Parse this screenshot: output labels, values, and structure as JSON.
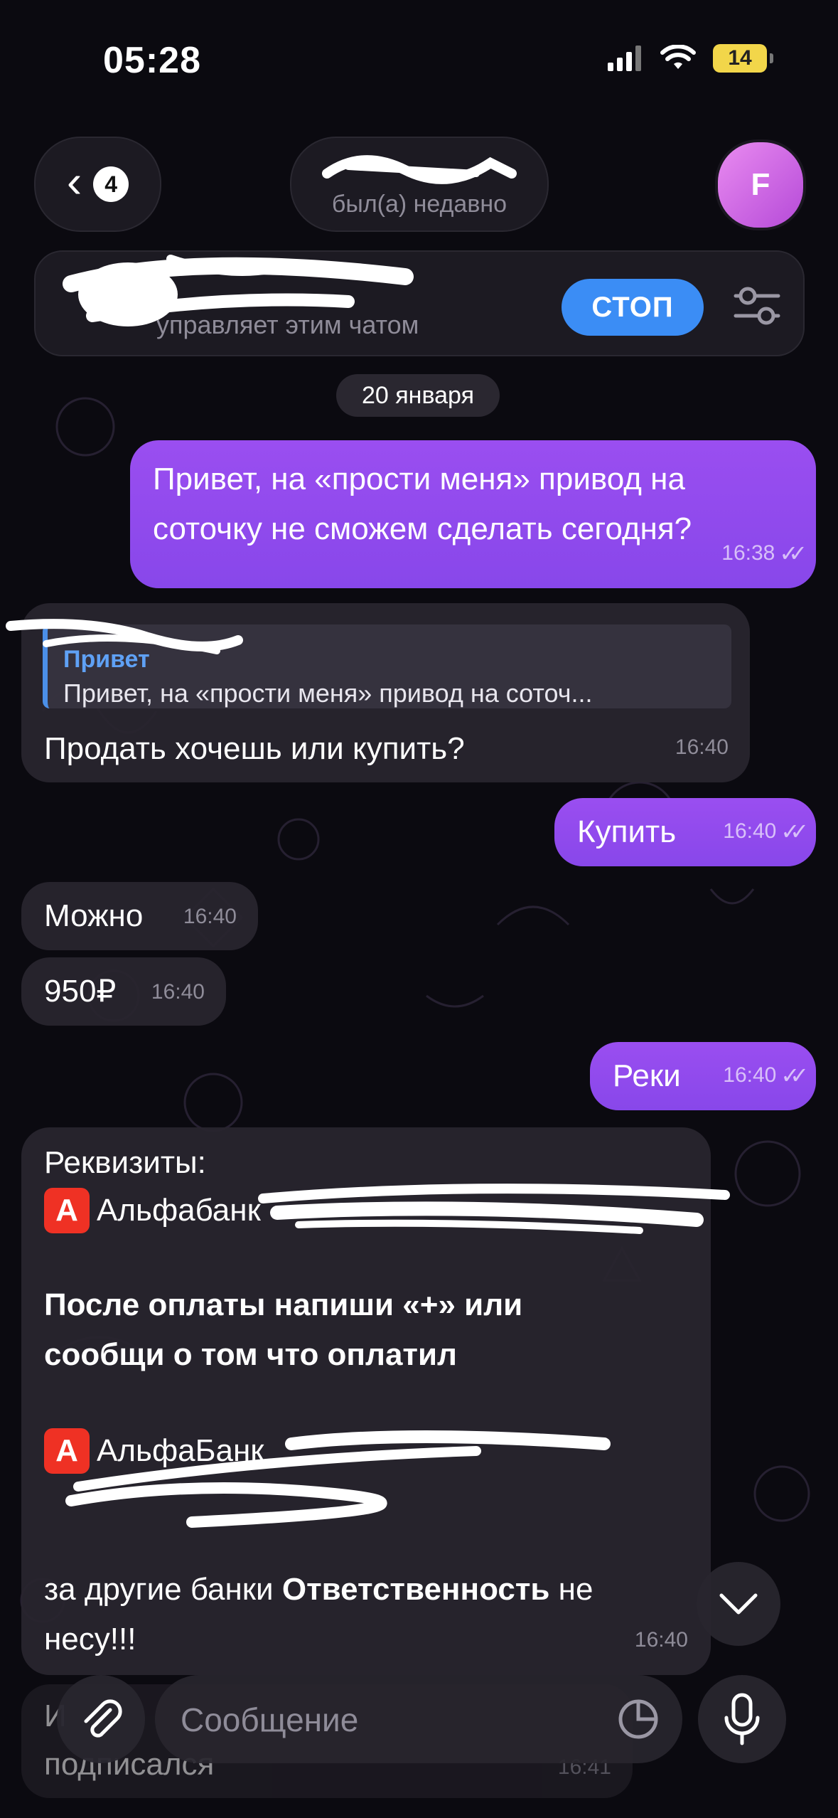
{
  "status_bar": {
    "time": "05:28",
    "battery": "14"
  },
  "header": {
    "back_badge": "4",
    "chat_status": "был(а) недавно",
    "avatar_letter": "F"
  },
  "bot_bar": {
    "text": "управляет этим чатом",
    "stop_label": "СТОП"
  },
  "date_separator": "20 января",
  "messages": [
    {
      "text": "Привет, на «прости меня» привод на соточку не сможем сделать сегодня?",
      "time": "16:38"
    },
    {
      "quote_name": "Привет",
      "quote_text": "Привет, на «прости меня» привод на соточ...",
      "text": "Продать хочешь или купить?",
      "time": "16:40"
    },
    {
      "text": "Купить",
      "time": "16:40"
    },
    {
      "text": "Можно",
      "time": "16:40"
    },
    {
      "text": "950₽",
      "time": "16:40"
    },
    {
      "text": "Реки",
      "time": "16:40"
    },
    {
      "line1": "Реквизиты:",
      "bank1": "Альфабанк",
      "bold_text": "После оплаты напиши «+» или сообщи о том что оплатил",
      "bank2": "АльфаБанк",
      "tail_regular_1": "за другие банки ",
      "tail_bold": "Ответственность",
      "tail_regular_2": " не несу!!!",
      "time": "16:40"
    },
    {
      "line_a": "И",
      "line_b": "подписался",
      "time": "16:41"
    }
  ],
  "composer": {
    "placeholder": "Сообщение"
  }
}
